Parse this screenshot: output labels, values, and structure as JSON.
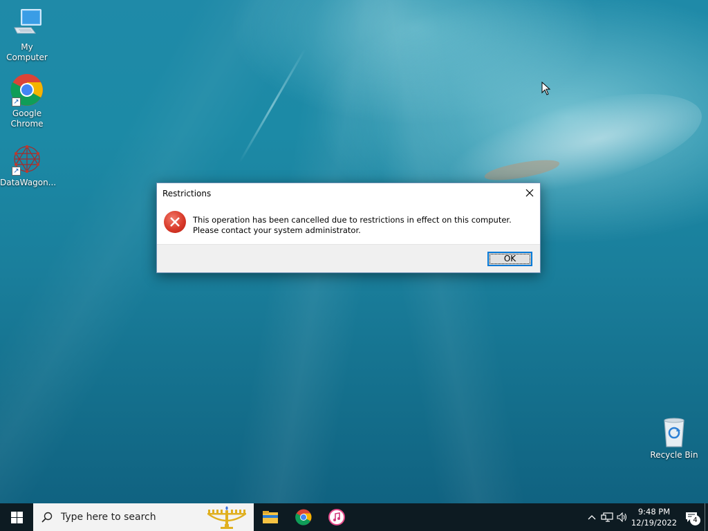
{
  "desktop": {
    "icons": [
      {
        "label": "My Computer",
        "icon": "computer-monitor-icon"
      },
      {
        "label": "Google Chrome",
        "icon": "chrome-icon"
      },
      {
        "label": "DataWagon...",
        "icon": "datawagon-icon"
      },
      {
        "label": "Recycle Bin",
        "icon": "recycle-bin-icon"
      }
    ]
  },
  "dialog": {
    "title": "Restrictions",
    "message": "This operation has been cancelled due to restrictions in effect on this computer. Please contact your system administrator.",
    "ok_label": "OK",
    "icon": "error-icon"
  },
  "taskbar": {
    "search_placeholder": "Type here to search",
    "apps": [
      "file-explorer-icon",
      "chrome-icon",
      "itunes-icon"
    ],
    "tray": {
      "time": "9:48 PM",
      "date": "12/19/2022",
      "notification_count": "4"
    }
  },
  "colors": {
    "accent": "#0078d7",
    "error": "#d83a2a",
    "taskbar": "#0d1b22"
  }
}
